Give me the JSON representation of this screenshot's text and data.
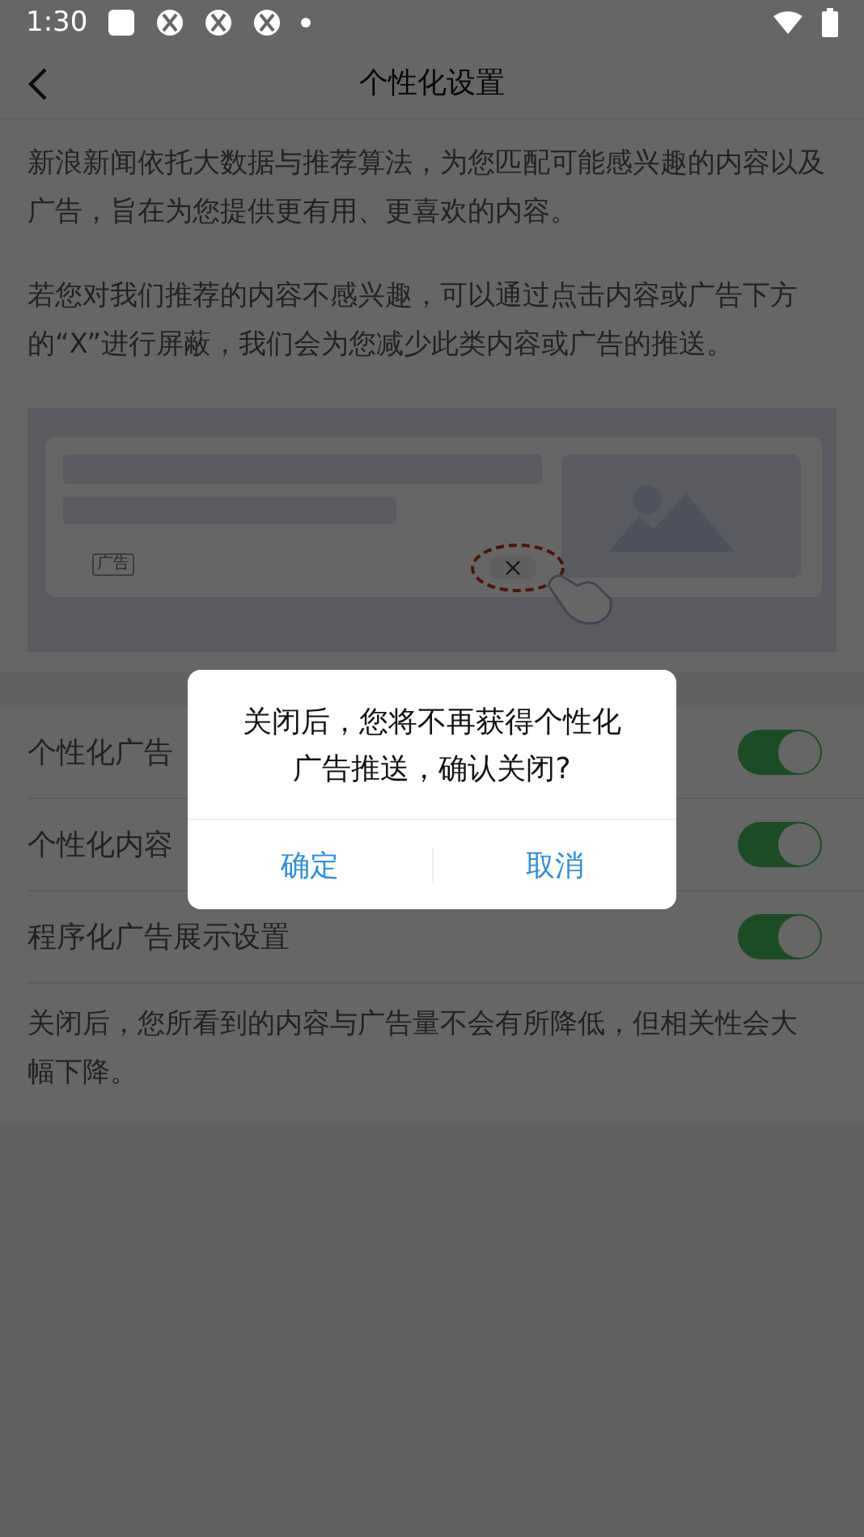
{
  "status_bar": {
    "time": "1:30"
  },
  "nav": {
    "title": "个性化设置"
  },
  "intro": [
    " 新浪新闻依托大数据与推荐算法，为您匹配可能感兴趣的内容以及广告，旨在为您提供更有用、更喜欢的内容。",
    "若您对我们推荐的内容不感兴趣，可以通过点击内容或广告下方的“X”进行屏蔽，我们会为您减少此类内容或广告的推送。"
  ],
  "illustration": {
    "tag": "广告"
  },
  "settings": [
    {
      "label": "个性化广告",
      "on": true
    },
    {
      "label": "个性化内容",
      "on": true
    },
    {
      "label": "程序化广告展示设置",
      "on": true
    }
  ],
  "footer_note": "关闭后，您所看到的内容与广告量不会有所降低，但相关性会大幅下降。",
  "dialog": {
    "message": "关闭后，您将不再获得个性化广告推送，确认关闭?",
    "buttons": [
      "确定",
      "取消"
    ]
  }
}
